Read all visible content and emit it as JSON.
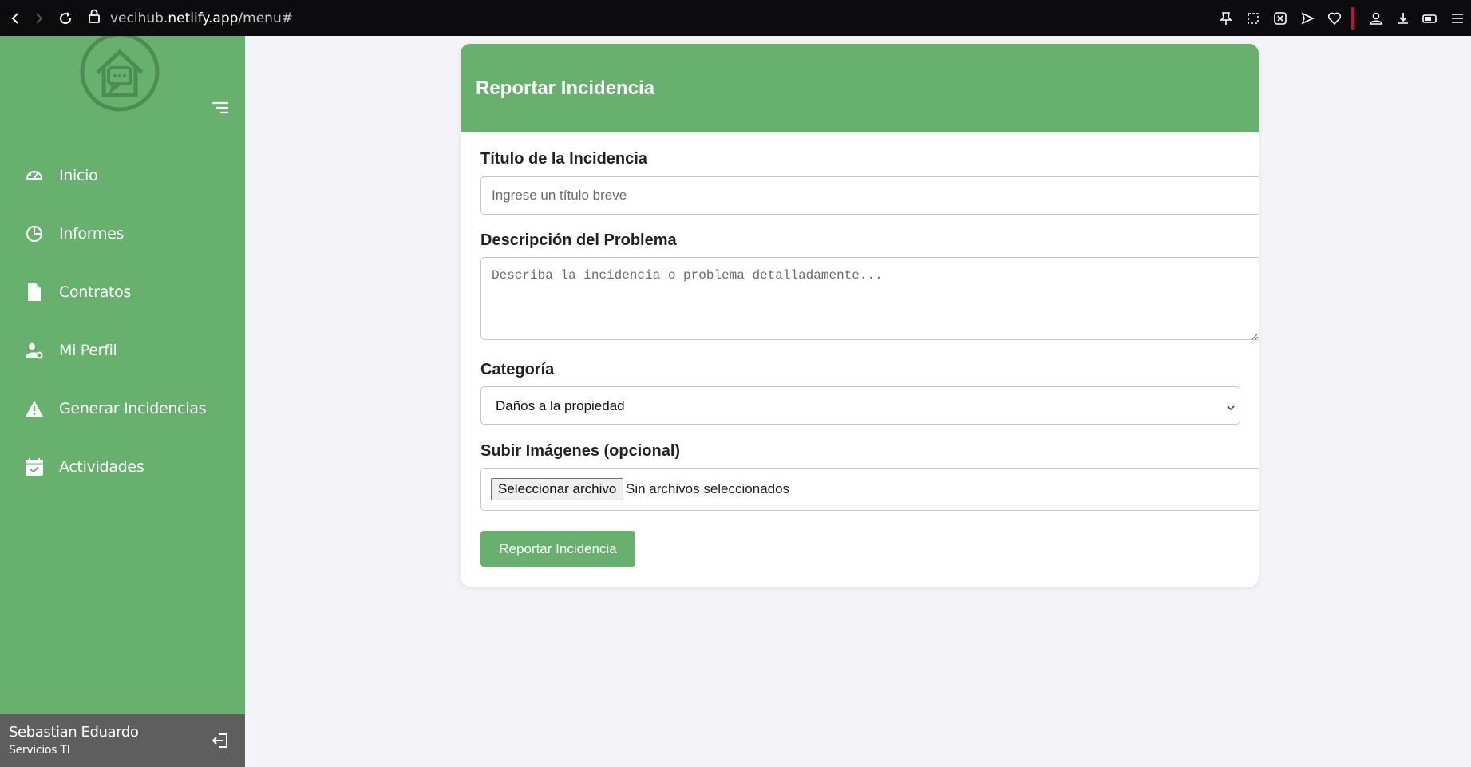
{
  "browser": {
    "url_prefix": "vecihub.",
    "url_domain": "netlify.app",
    "url_path": "/menu#"
  },
  "sidebar": {
    "logo_icon": "house-chat-icon",
    "items": [
      {
        "label": "Inicio",
        "icon": "speedometer-icon"
      },
      {
        "label": "Informes",
        "icon": "pie-chart-icon"
      },
      {
        "label": "Contratos",
        "icon": "document-icon"
      },
      {
        "label": "Mi Perfil",
        "icon": "user-gear-icon"
      },
      {
        "label": "Generar Incidencias",
        "icon": "warning-icon"
      },
      {
        "label": "Actividades",
        "icon": "calendar-check-icon"
      }
    ],
    "user": {
      "name": "Sebastian Eduardo",
      "role": "Servicios TI"
    }
  },
  "card": {
    "title": "Reportar Incidencia",
    "fields": {
      "title_label": "Título de la Incidencia",
      "title_placeholder": "Ingrese un título breve",
      "description_label": "Descripción del Problema",
      "description_placeholder": "Describa la incidencia o problema detalladamente...",
      "category_label": "Categoría",
      "category_value": "Daños a la propiedad",
      "images_label": "Subir Imágenes (opcional)",
      "file_button": "Seleccionar archivo",
      "file_status": "Sin archivos seleccionados"
    },
    "submit_label": "Reportar Incidencia"
  },
  "colors": {
    "primary": "#68b06e",
    "sidebar_user_bg": "#5e5e5e",
    "page_bg": "#f4f4f8",
    "browser_bg": "#0c0c0e"
  }
}
